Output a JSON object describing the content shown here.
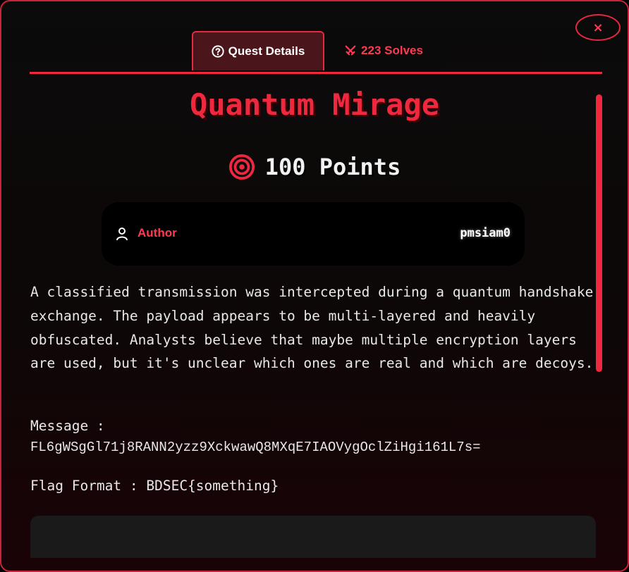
{
  "modal": {
    "close_label": "×",
    "tabs": [
      {
        "label": "Quest Details",
        "icon": "question-circle-icon"
      },
      {
        "label": "223 Solves",
        "icon": "crossed-swords-icon"
      }
    ]
  },
  "challenge": {
    "title": "Quantum Mirage",
    "points_label": "100 Points",
    "author_label": "Author",
    "author_value": "pmsiam0",
    "description": "A classified transmission was intercepted during a quantum handshake exchange. The payload appears to be multi-layered and heavily obfuscated. Analysts believe that maybe multiple encryption layers are used, but it's unclear which ones are real and which are decoys.",
    "message_label": "Message :",
    "message_value": "FL6gWSgGl71j8RANN2yzz9XckwawQ8MXqE7IAOVygOclZiHgi161L7s=",
    "flag_format": "Flag Format : BDSEC{something}"
  },
  "colors": {
    "accent": "#f0283e",
    "tab_active_bg": "#4a151b",
    "card_bg": "#000000",
    "text": "#e8e8e8"
  }
}
